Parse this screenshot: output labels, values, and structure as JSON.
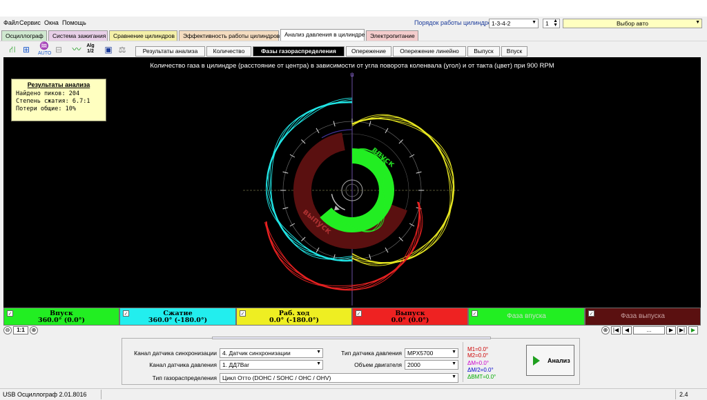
{
  "menu": [
    "Файл",
    "Сервис",
    "Окна",
    "Помощь"
  ],
  "cylinder_order": {
    "label": "Порядок работы цилиндров",
    "value": "1-3-4-2",
    "spin_value": "1"
  },
  "auto_select": "Выбор авто",
  "tabs": [
    {
      "label": "Осциллограф",
      "color": "#cfe8cf"
    },
    {
      "label": "Система зажигания",
      "color": "#e8cfe8"
    },
    {
      "label": "Сравнение цилиндров",
      "color": "#f4f0a8"
    },
    {
      "label": "Эффективность работы цилиндров",
      "color": "#f4dcc0"
    },
    {
      "label": "Анализ давления в цилиндре",
      "color": "#ffffff"
    },
    {
      "label": "Электропитание",
      "color": "#f4cccc"
    }
  ],
  "toolbar": {
    "icons": [
      "sync-icon",
      "hierarchy-icon",
      "auto-icon",
      "grid-icon",
      "curve-icon",
      "algorithm-icon",
      "save-icon",
      "scale-icon"
    ],
    "alg_label": "Alg",
    "alg_sub": "1/2",
    "auto_label": "AUTO",
    "subtabs": [
      "Результаты анализа",
      "Количество",
      "Фазы газораспределения",
      "Опережение",
      "Опережение линейно",
      "Выпуск",
      "Впуск"
    ]
  },
  "plot": {
    "title": "Количество газа в цилиндре (расстояние от центра) в зависимости от угла поворота коленвала (угол) и от такта (цвет) при 900 RPM",
    "marker": "u",
    "intake_arc_label": "впуск",
    "exhaust_arc_label": "выпуск",
    "colors": {
      "intake": "#22ee22",
      "compression": "#22eeee",
      "power": "#eeee22",
      "exhaust": "#ee2222",
      "exhaust_phase": "#5a1010"
    }
  },
  "results": {
    "header": "Результаты анализа",
    "lines": [
      "Найдено пиков: 204",
      "Степень сжатия: 6.7:1",
      "Потери общие: 10%"
    ]
  },
  "legend": [
    {
      "name": "Впуск",
      "value": "360.0° (0.0°)",
      "bg": "#22ee22"
    },
    {
      "name": "Сжатие",
      "value": "360.0° (-180.0°)",
      "bg": "#22eeee"
    },
    {
      "name": "Раб. ход",
      "value": "0.0° (-180.0°)",
      "bg": "#eeee22"
    },
    {
      "name": "Выпуск",
      "value": "0.0° (0.0°)",
      "bg": "#ee2222"
    },
    {
      "name": "Фаза впуска",
      "value": "",
      "bg": "#22ee22"
    },
    {
      "name": "Фаза выпуска",
      "value": "",
      "bg": "#5a1010"
    }
  ],
  "check_mark": "✓",
  "scale": {
    "value": "1:1",
    "minus": "⊖",
    "plus": "⊕",
    "nav_dots": "...",
    "nav_first": "|◀",
    "nav_prev": "◀",
    "nav_next": "▶",
    "nav_last": "▶|",
    "nav_play": "▶"
  },
  "settings": {
    "sync_channel_label": "Канал датчика синхронизации",
    "sync_channel_value": "4. Датчик синхронизации",
    "pressure_channel_label": "Канал датчика давления",
    "pressure_channel_value": "1. ДД7Bar",
    "timing_type_label": "Тип газораспределения",
    "timing_type_value": "Цикл Отто (DOHC / SOHC / OHC / OHV)",
    "sensor_type_label": "Тип датчика давления",
    "sensor_type_value": "MPX5700",
    "engine_volume_label": "Объем двигателя",
    "engine_volume_value": "2000",
    "cursors": [
      {
        "text": "M1=0.0°",
        "color": "#cc0000"
      },
      {
        "text": "M2=0.0°",
        "color": "#cc0000"
      },
      {
        "text": "ΔM=0.0°",
        "color": "#cc00cc"
      },
      {
        "text": "ΔM/2=0.0°",
        "color": "#0000cc"
      },
      {
        "text": "ΔВМТ=0.0°",
        "color": "#00aa00"
      }
    ],
    "analyze_label": "Анализ"
  },
  "status": {
    "app": "USB Осциллограф  2.01.8016",
    "right": "2.4"
  }
}
